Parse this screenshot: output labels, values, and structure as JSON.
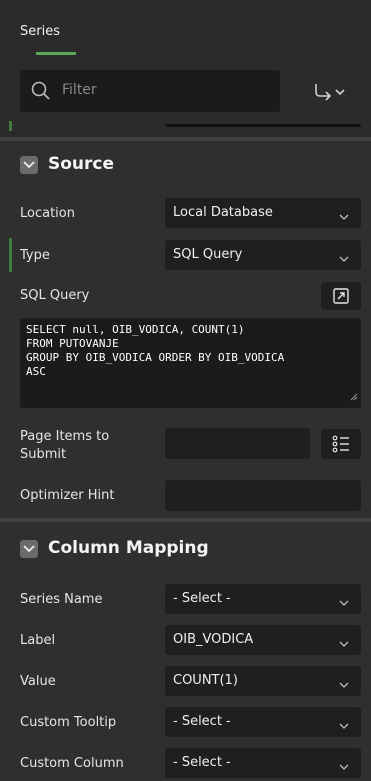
{
  "tabs": [
    {
      "label": "Series",
      "active": true
    }
  ],
  "filter": {
    "placeholder": "Filter"
  },
  "source": {
    "title": "Source",
    "location": {
      "label": "Location",
      "value": "Local Database"
    },
    "type": {
      "label": "Type",
      "value": "SQL Query"
    },
    "sql_query": {
      "label": "SQL Query",
      "value": "SELECT null, OIB_VODICA, COUNT(1)\nFROM PUTOVANJE\nGROUP BY OIB_VODICA ORDER BY OIB_VODICA\nASC"
    },
    "page_items": {
      "label": "Page Items to Submit",
      "value": ""
    },
    "optimizer_hint": {
      "label": "Optimizer Hint",
      "value": ""
    }
  },
  "column_mapping": {
    "title": "Column Mapping",
    "series_name": {
      "label": "Series Name",
      "value": "- Select -"
    },
    "label": {
      "label": "Label",
      "value": "OIB_VODICA"
    },
    "value": {
      "label": "Value",
      "value": "COUNT(1)"
    },
    "custom_tooltip": {
      "label": "Custom Tooltip",
      "value": "- Select -"
    },
    "custom_column": {
      "label": "Custom Column",
      "value": "- Select -"
    }
  },
  "colors": {
    "accent": "#5aa95a",
    "background": "#2b2b2b",
    "field": "#1f1f1f"
  }
}
